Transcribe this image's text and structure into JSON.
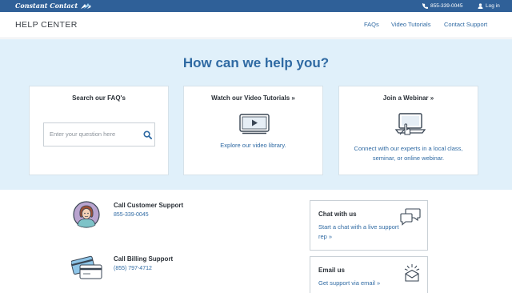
{
  "topbar": {
    "brand": "Constant Contact",
    "phone": "855-339-0045",
    "login": "Log in"
  },
  "header": {
    "title": "HELP CENTER",
    "nav": [
      "FAQs",
      "Video Tutorials",
      "Contact Support"
    ]
  },
  "hero": {
    "heading": "How can we help you?",
    "cards": [
      {
        "title": "Search our FAQ's",
        "search_placeholder": "Enter your question here",
        "search_value": ""
      },
      {
        "title": "Watch our Video Tutorials »",
        "link": "Explore our video library."
      },
      {
        "title": "Join a Webinar »",
        "link_line1": "Connect with our experts in a local class,",
        "link_line2": "seminar, or online webinar."
      }
    ]
  },
  "support": {
    "customer": {
      "title": "Call Customer Support",
      "phone": "855-339-0045"
    },
    "billing": {
      "title": "Call Billing Support",
      "phone": "(855) 797-4712"
    },
    "chat": {
      "title": "Chat with us",
      "link": "Start a chat with a live support rep »"
    },
    "email": {
      "title": "Email us",
      "link": "Get support via email »"
    }
  },
  "colors": {
    "topbar": "#2f6098",
    "accent": "#2f6aa3",
    "hero_bg": "#e0f0fa"
  },
  "icons": [
    "wing-logo-icon",
    "phone-icon",
    "user-icon",
    "search-icon",
    "video-player-icon",
    "webinar-laptop-icon",
    "support-agent-avatar",
    "credit-cards-icon",
    "chat-bubbles-icon",
    "email-envelope-icon"
  ]
}
